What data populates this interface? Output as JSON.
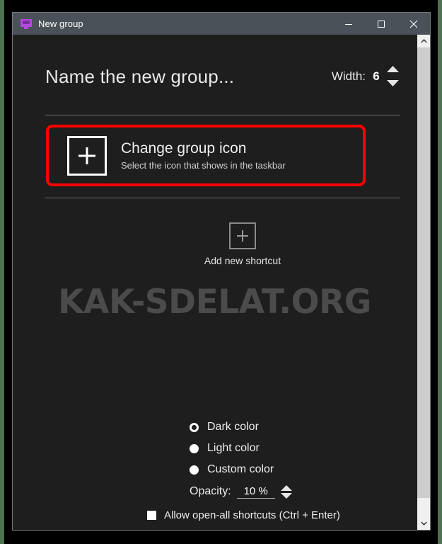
{
  "window": {
    "title": "New group",
    "icon": "monitor-icon",
    "accent_color": "#b44ae0",
    "titlebar_color": "#4a5158",
    "content_color": "#1e1e1e",
    "controls": {
      "minimize": "minimize-icon",
      "maximize": "maximize-icon",
      "close": "close-icon"
    }
  },
  "header": {
    "group_name_placeholder": "Name the new group...",
    "group_name_value": "Name the new group...",
    "width_label": "Width:",
    "width_value": "6"
  },
  "change_icon": {
    "title": "Change group icon",
    "subtitle": "Select the icon that shows in the taskbar",
    "thumb_icon": "plus-icon",
    "highlight_color": "#ff0000"
  },
  "shortcuts": {
    "add_label": "Add new shortcut",
    "add_icon": "plus-icon"
  },
  "watermark": {
    "text": "KAK-SDELAT.ORG"
  },
  "options": {
    "color_modes": [
      {
        "label": "Dark color",
        "selected": true
      },
      {
        "label": "Light color",
        "selected": false
      },
      {
        "label": "Custom color",
        "selected": false
      }
    ],
    "opacity_label": "Opacity:",
    "opacity_value": "10 %",
    "allow_open_all_label": "Allow open-all shortcuts (Ctrl + Enter)",
    "allow_open_all_checked": true
  },
  "scrollbar": {
    "up_arrow": "chevron-up-icon",
    "down_arrow": "chevron-down-icon"
  }
}
